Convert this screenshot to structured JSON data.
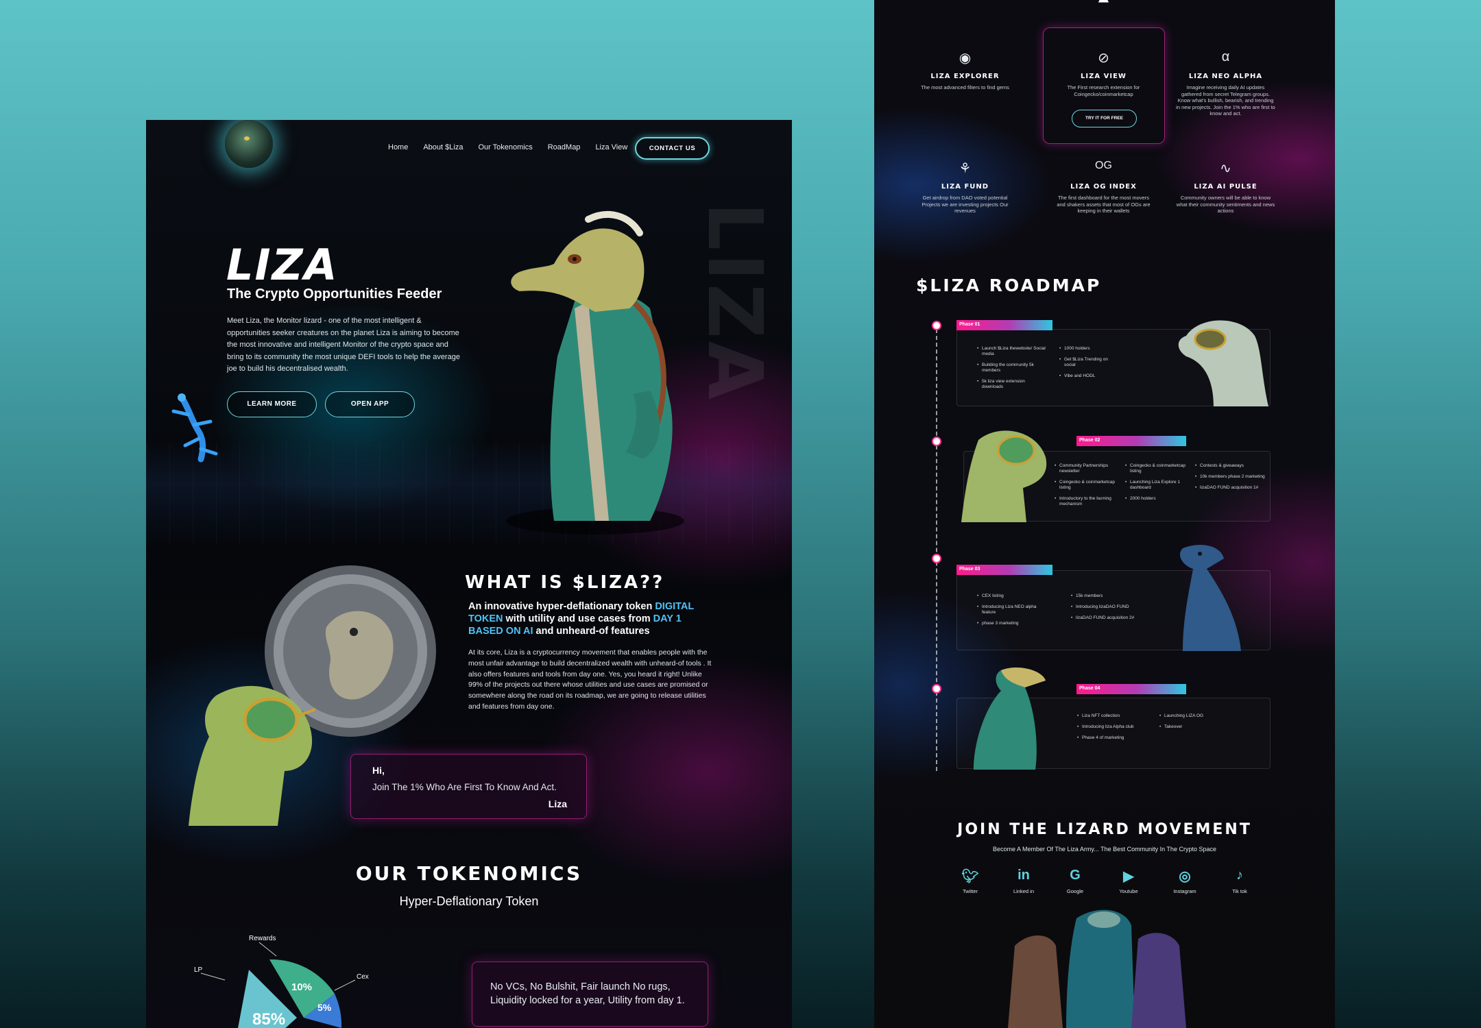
{
  "left": {
    "nav": {
      "items": [
        "Home",
        "About $Liza",
        "Our Tokenomics",
        "RoadMap",
        "Liza View"
      ],
      "contact": "CONTACT US"
    },
    "hero": {
      "title": "LIZA",
      "subtitle": "The Crypto Opportunities Feeder",
      "description": "Meet Liza, the Monitor lizard - one of the most intelligent & opportunities seeker creatures on the planet Liza is aiming to become the most innovative and intelligent Monitor of the crypto space and bring to its community the most unique DEFI tools to help the average joe to build his decentralised wealth.",
      "btn_learn": "LEARN MORE",
      "btn_open": "OPEN APP",
      "vertical_word": "LIZA"
    },
    "what": {
      "title": "WHAT IS $LIZA??",
      "sub_a": "An innovative hyper-deflationary token ",
      "sub_hl1": "DIGITAL TOKEN",
      "sub_b": " with utility and use cases from ",
      "sub_hl2": "DAY 1 BASED ON AI",
      "sub_c": " and unheard-of features",
      "description": "At its core, Liza is a cryptocurrency movement that enables people with the most unfair advantage to build decentralized wealth with unheard-of tools . It also offers features and tools from day one. Yes, you heard it right! Unlike 99% of the projects out there whose utilities and use cases are promised or somewhere along the road on its roadmap, we are going to release utilities and features from day one."
    },
    "hi_card": {
      "greeting": "Hi,",
      "text": "Join The 1% Who Are First To Know And Act.",
      "sign": "Liza"
    },
    "tokenomics": {
      "title": "OUR TOKENOMICS",
      "subtitle": "Hyper-Deflationary Token",
      "labels": {
        "rewards": "Rewards",
        "lp": "LP",
        "cex": "Cex"
      },
      "values": {
        "lp": "85%",
        "rewards": "10%",
        "cex": "5%"
      },
      "card_text": "No VCs, No Bulshit, Fair launch No rugs, Liquidity locked for a year, Utility from day 1."
    }
  },
  "right": {
    "features": [
      {
        "icon": "eye-icon",
        "name": "LIZA EXPLORER",
        "desc": "The most advanced filters to find gems"
      },
      {
        "icon": "compass-icon",
        "name": "LIZA VIEW",
        "desc": "The First research extension for Coingecko/coinmarketcap",
        "cta": "TRY IT FOR FREE"
      },
      {
        "icon": "alpha-icon",
        "name": "LIZA NEO ALPHA",
        "desc": "Imagine receiving daily AI updates gathered from secret Telegram groups. Know what's bullish, bearish, and trending in new projects. Join the 1% who are first to know and act."
      },
      {
        "icon": "plant-icon",
        "name": "LIZA FUND",
        "desc": "Get airdrop from DAO voted potential Projects we are investing projects Our revenues"
      },
      {
        "icon": "og-icon",
        "name": "LIZA OG INDEX",
        "desc": "The first dashboard for the most movers and shakers assets that most of OGs are keeping in their wallets"
      },
      {
        "icon": "pulse-icon",
        "name": "LIZA AI PULSE",
        "desc": "Community owners will be able to know what their community sentiments and news actions"
      }
    ],
    "roadmap": {
      "title": "$LIZA ROADMAP",
      "phases": [
        {
          "tag": "Phase 01",
          "col1": [
            "Launch $Liza thewebsite/ Social media",
            "Building the community 5k members",
            "5k liza view extension downloads"
          ],
          "col2": [
            "1000 holders",
            "Get $Liza Trending on social",
            "Vibe and HODL"
          ]
        },
        {
          "tag": "Phase 02",
          "col1": [
            "Community Partnerships newsletter",
            "Coingecko & coinmarketcap listing",
            "Introductory to the burning mechanism"
          ],
          "col2": [
            "Coingecko & coinmarketcap listing",
            "Launching Liza Explore 1 dashboard",
            "2000 holders"
          ],
          "col3": [
            "Contests & giveaways",
            "10k members phase 2 marketing",
            "lizaDAO FUND acquisition 1#"
          ]
        },
        {
          "tag": "Phase 03",
          "col1": [
            "CEX listing",
            "Introducing Liza NEO alpha feature",
            "phase 3 marketing"
          ],
          "col2": [
            "15k members",
            "Introducing lizaDAO FUND",
            "lizaDAO FUND acquisition 2#"
          ]
        },
        {
          "tag": "Phase 04",
          "col1": [
            "Liza NFT collection",
            "Introducing liza Alpha club",
            "Phase 4 of marketing"
          ],
          "col2": [
            "Launching LIZA OG",
            "Takeover"
          ]
        }
      ]
    },
    "join": {
      "title": "JOIN THE LIZARD MOVEMENT",
      "subtitle": "Become A Member Of The Liza Army... The Best Community In The Crypto Space",
      "socials": [
        "Twitter",
        "Linked in",
        "Google",
        "Youtube",
        "Instagram",
        "Tik tok"
      ]
    }
  }
}
